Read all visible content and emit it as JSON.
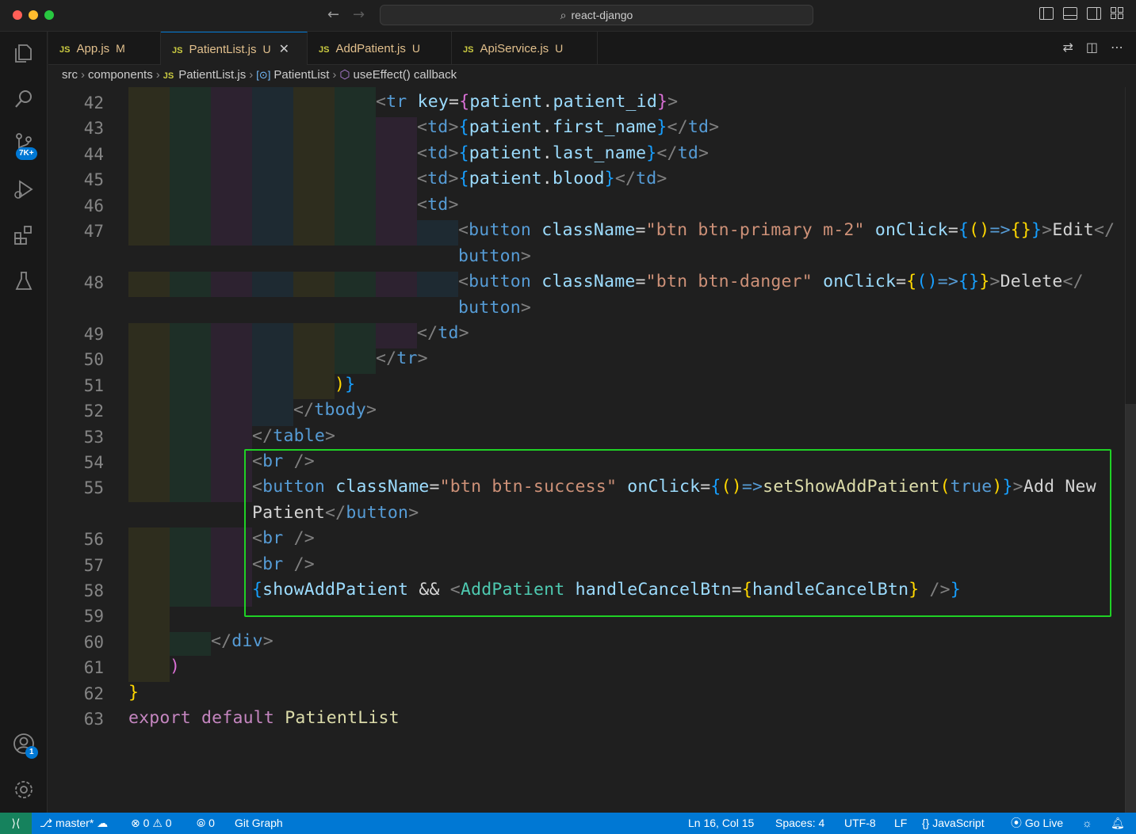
{
  "window": {
    "title": "react-django"
  },
  "activity_bar": {
    "source_control_badge": "7K+",
    "accounts_badge": "1"
  },
  "tabs": [
    {
      "label": "App.js",
      "status": "M"
    },
    {
      "label": "PatientList.js",
      "status": "U"
    },
    {
      "label": "AddPatient.js",
      "status": "U"
    },
    {
      "label": "ApiService.js",
      "status": "U"
    }
  ],
  "tab_icon_text": "JS",
  "breadcrumb": {
    "parts": [
      "src",
      "components",
      "PatientList.js",
      "PatientList",
      "useEffect() callback"
    ]
  },
  "editor": {
    "line_numbers": [
      "42",
      "43",
      "44",
      "45",
      "46",
      "47",
      "48",
      "49",
      "50",
      "51",
      "52",
      "53",
      "54",
      "55",
      "56",
      "57",
      "58",
      "59",
      "60",
      "61",
      "62",
      "63"
    ],
    "highlight_color": "#1fd125"
  },
  "statusbar": {
    "branch": "master*",
    "errors": "0",
    "warnings": "0",
    "ports": "0",
    "git_graph": "Git Graph",
    "position": "Ln 16, Col 15",
    "spaces": "Spaces: 4",
    "encoding": "UTF-8",
    "eol": "LF",
    "language": "JavaScript",
    "go_live": "Go Live",
    "accent_color": "#0078d4"
  }
}
